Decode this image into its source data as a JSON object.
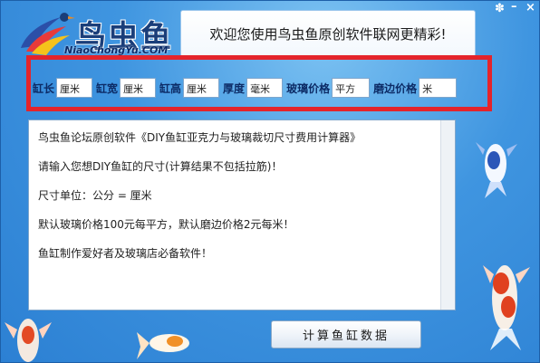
{
  "app": {
    "logo_text": "鸟虫鱼",
    "logo_url": "NiaoChongYu.COM",
    "welcome": "欢迎您使用鸟虫鱼原创软件联网更精彩!"
  },
  "controls": {
    "gear_icon": "gear-icon",
    "min_icon": "minimize-icon",
    "close_icon": "close-icon",
    "min_glyph": "–",
    "close_glyph": "×",
    "gear_glyph": "✽"
  },
  "fields": [
    {
      "label": "缸长",
      "unit": "厘米"
    },
    {
      "label": "缸宽",
      "unit": "厘米"
    },
    {
      "label": "缸高",
      "unit": "厘米"
    },
    {
      "label": "厚度",
      "unit": "毫米"
    },
    {
      "label": "玻璃价格",
      "unit": "平方"
    },
    {
      "label": "磨边价格",
      "unit": "米"
    }
  ],
  "info": {
    "line1": "鸟虫鱼论坛原创软件《DIY鱼缸亚克力与玻璃裁切尺寸费用计算器》",
    "line2": "请输入您想DIY鱼缸的尺寸(计算结果不包括拉筋)！",
    "line3": "尺寸单位：公分 = 厘米",
    "line4": "默认玻璃价格100元每平方，默认磨边价格2元每米！",
    "line5": "鱼缸制作爱好者及玻璃店必备软件！"
  },
  "button": {
    "calc_label": "计算鱼缸数据"
  },
  "colors": {
    "accent": "#e4242b",
    "label": "#0c2b66",
    "background": "#3f95e0"
  }
}
